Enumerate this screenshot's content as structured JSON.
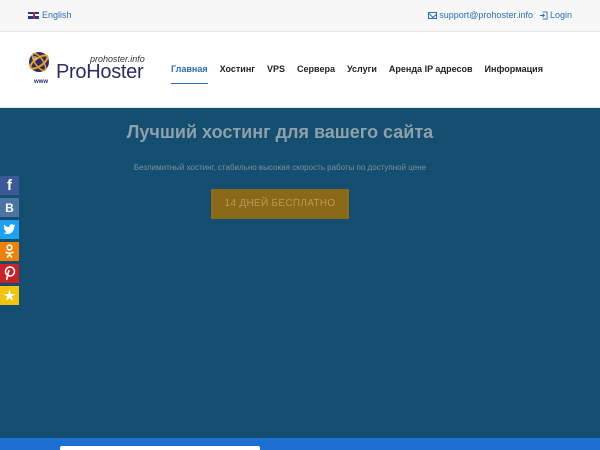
{
  "topbar": {
    "language": "English",
    "support_email": "support@prohoster.info",
    "login": "Login"
  },
  "logo": {
    "url_text": "prohoster.info",
    "name": "ProHoster",
    "www": "www"
  },
  "nav": {
    "items": [
      "Главная",
      "Хостинг",
      "VPS",
      "Сервера",
      "Услуги",
      "Аренда IP адресов",
      "Информация"
    ],
    "active_index": 0
  },
  "hero": {
    "title": "Лучший хостинг для вашего сайта",
    "subtitle": "Безлимитный хостинг, стабильно высокая скорость работы по доступной цене",
    "cta": "14 ДНЕЙ БЕСПЛАТНО"
  },
  "social": [
    {
      "name": "facebook-icon",
      "glyph": "f"
    },
    {
      "name": "vk-icon",
      "glyph": "В"
    },
    {
      "name": "twitter-icon",
      "glyph": ""
    },
    {
      "name": "odnoklassniki-icon",
      "glyph": ""
    },
    {
      "name": "pinterest-icon",
      "glyph": ""
    },
    {
      "name": "favorites-icon",
      "glyph": "★"
    }
  ],
  "colors": {
    "hero_bg": "#144e70",
    "accent": "#2a6ebb",
    "cta_bg": "#8a6a18"
  }
}
